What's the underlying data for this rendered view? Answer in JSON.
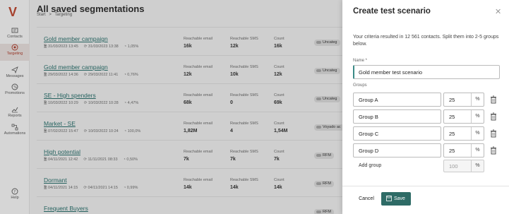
{
  "app": {
    "logo": "V",
    "accent": "#2e6b66",
    "link_color": "#2a6a67",
    "brand_color": "#b0442f"
  },
  "nav": {
    "items": [
      {
        "label": "Contacts",
        "icon": "contacts-icon"
      },
      {
        "label": "Targeting",
        "icon": "targeting-icon",
        "active": true
      },
      {
        "label": "Messages",
        "icon": "send-icon"
      },
      {
        "label": "Promotions",
        "icon": "promotions-icon"
      },
      {
        "label": "Reports",
        "icon": "chart-icon"
      },
      {
        "label": "Automations",
        "icon": "automation-icon"
      }
    ],
    "help": "Help"
  },
  "page": {
    "title": "All saved segmentations",
    "breadcrumb": [
      "Start",
      ">",
      "Targeting"
    ]
  },
  "columns": {
    "email": "Reachable email",
    "sms": "Reachable SMS",
    "count": "Count"
  },
  "segments": [
    {
      "name": "Gold member campaign",
      "created": "31/03/2023 13:45",
      "updated": "31/03/2023 13:38",
      "pct": "1,05%",
      "email": "16k",
      "sms": "12k",
      "count": "16k",
      "tag": "Uncateg"
    },
    {
      "name": "Gold member campaign",
      "created": "29/03/2022 14:36",
      "updated": "29/03/2022 11:41",
      "pct": "0,76%",
      "email": "12k",
      "sms": "10k",
      "count": "12k",
      "tag": "Uncateg"
    },
    {
      "name": "SE - High spenders",
      "created": "10/03/2022 10:29",
      "updated": "10/03/2022 10:28",
      "pct": "4,47%",
      "email": "68k",
      "sms": "0",
      "count": "69k",
      "tag": "Uncateg"
    },
    {
      "name": "Market - SE",
      "created": "07/02/2022 15:47",
      "updated": "10/03/2022 10:24",
      "pct": "100,0%",
      "email": "1,82M",
      "sms": "4",
      "count": "1,54M",
      "tag": "Voyado ac"
    },
    {
      "name": "High potential",
      "created": "04/11/2021 12:42",
      "updated": "11/11/2021 08:33",
      "pct": "0,50%",
      "email": "7k",
      "sms": "7k",
      "count": "7k",
      "tag": "RFM"
    },
    {
      "name": "Dormant",
      "created": "04/11/2021 14:15",
      "updated": "04/11/2021 14:15",
      "pct": "0,99%",
      "email": "14k",
      "sms": "14k",
      "count": "14k",
      "tag": "RFM"
    },
    {
      "name": "Frequent Buyers",
      "created": "",
      "updated": "",
      "pct": "",
      "email": "",
      "sms": "",
      "count": "",
      "tag": "RFM"
    }
  ],
  "panel": {
    "title": "Create test scenario",
    "description": "Your criteria resulted in 12 561 contacts. Split them into 2-5 groups below.",
    "name_label": "Name *",
    "name_value": "Gold member test scenario",
    "groups_label": "Groups",
    "groups": [
      {
        "name": "Group A",
        "pct": "25"
      },
      {
        "name": "Group B",
        "pct": "25"
      },
      {
        "name": "Group C",
        "pct": "25"
      },
      {
        "name": "Group D",
        "pct": "25"
      }
    ],
    "pct_symbol": "%",
    "add_group": "Add group",
    "total": "100",
    "cancel": "Cancel",
    "save": "Save"
  }
}
